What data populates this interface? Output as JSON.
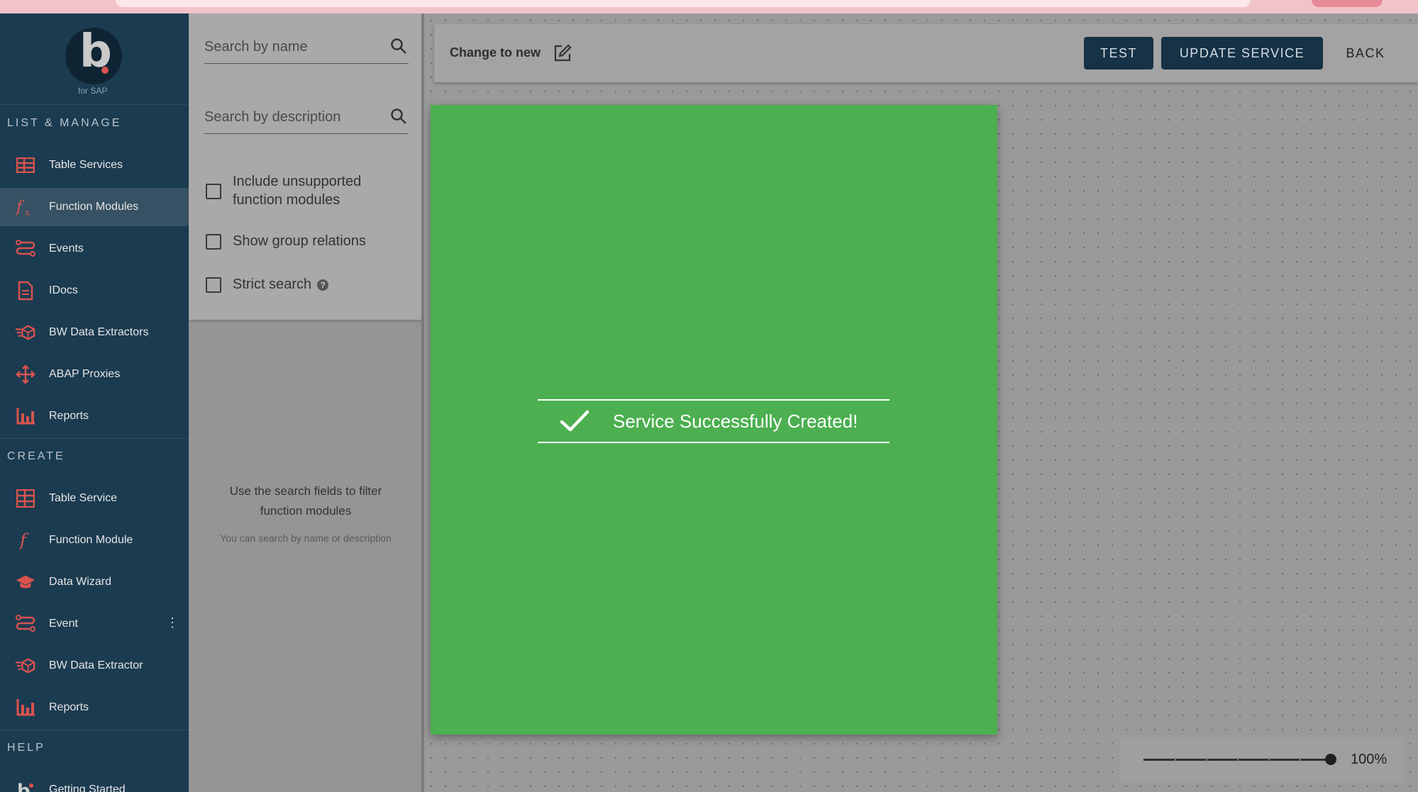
{
  "logo": {
    "letter": "b",
    "subtitle": "for SAP"
  },
  "sidebar": {
    "sections": {
      "list_manage": "LIST & MANAGE",
      "create": "CREATE",
      "help": "HELP"
    },
    "list_items": [
      {
        "label": "Table Services",
        "icon": "table-icon"
      },
      {
        "label": "Function Modules",
        "icon": "function-icon",
        "active": true
      },
      {
        "label": "Events",
        "icon": "events-icon"
      },
      {
        "label": "IDocs",
        "icon": "document-icon"
      },
      {
        "label": "BW Data Extractors",
        "icon": "extractor-icon"
      },
      {
        "label": "ABAP Proxies",
        "icon": "proxy-icon"
      },
      {
        "label": "Reports",
        "icon": "bar-chart-icon"
      }
    ],
    "create_items": [
      {
        "label": "Table Service",
        "icon": "table-add-icon"
      },
      {
        "label": "Function Module",
        "icon": "function-icon"
      },
      {
        "label": "Data Wizard",
        "icon": "wizard-hat-icon"
      },
      {
        "label": "Event",
        "icon": "events-icon"
      },
      {
        "label": "BW Data Extractor",
        "icon": "extractor-icon"
      },
      {
        "label": "Reports",
        "icon": "bar-chart-icon"
      }
    ],
    "help_items": [
      {
        "label": "Getting Started",
        "icon": "b-logo-icon"
      }
    ],
    "accent_color": "#d9534f"
  },
  "filter": {
    "search_name_placeholder": "Search by name",
    "search_desc_placeholder": "Search by description",
    "checkbox_unsupported": "Include unsupported function modules",
    "checkbox_group": "Show group relations",
    "checkbox_strict": "Strict search",
    "hint": "Use the search fields to filter function modules",
    "subhint": "You can search by name or description"
  },
  "toolbar": {
    "title": "Change to new",
    "test_label": "TEST",
    "update_label": "UPDATE SERVICE",
    "back_label": "BACK"
  },
  "notification": {
    "message": "Service Successfully Created!",
    "background": "#4caf50"
  },
  "zoom": {
    "value": "100%",
    "level": 1.0
  }
}
